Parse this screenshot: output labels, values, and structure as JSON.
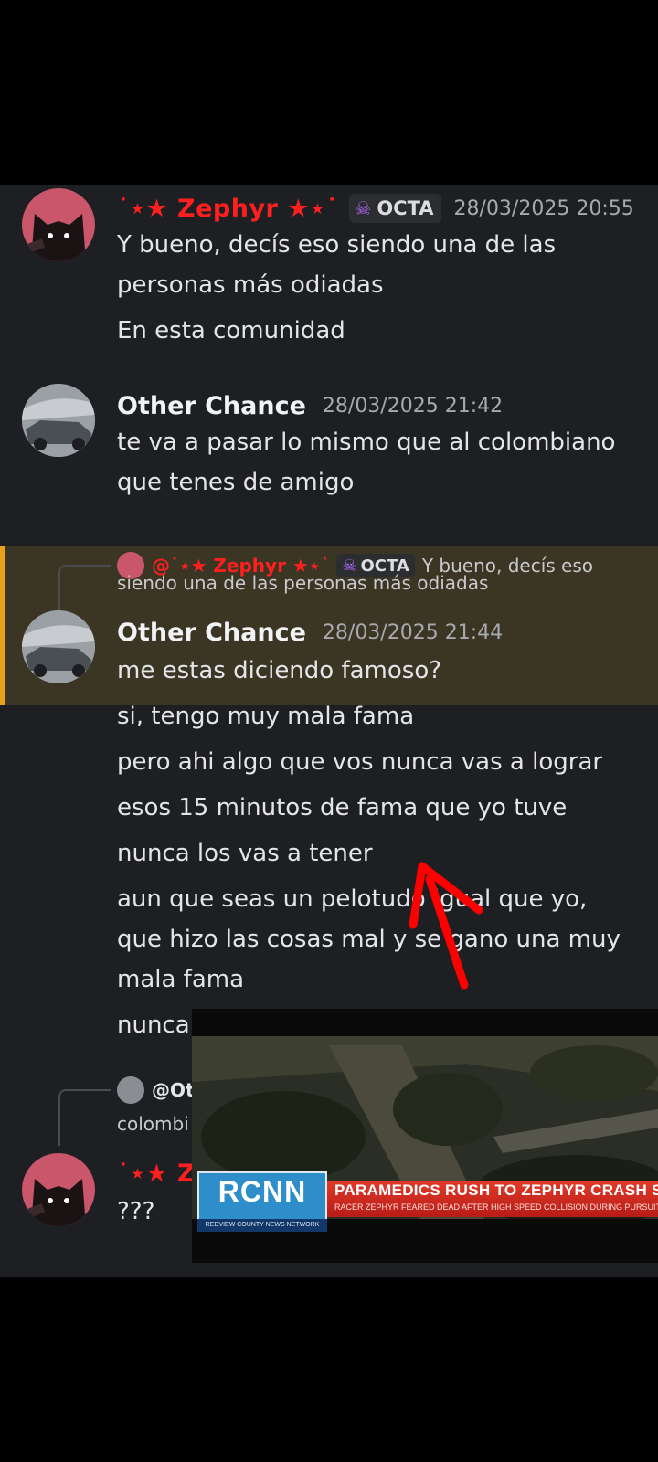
{
  "messages": [
    {
      "author": "˙⋆★ Zephyr ★⋆˙",
      "badge": "OCTA",
      "time": "28/03/2025 20:55",
      "lines": [
        "Y bueno, decís eso siendo una de las",
        "personas más odiadas",
        "En esta comunidad"
      ]
    },
    {
      "author": "Other Chance",
      "time": "28/03/2025 21:42",
      "lines": [
        "te va a pasar lo mismo que al colombiano",
        "que tenes de amigo"
      ]
    },
    {
      "reply": {
        "author": "@˙⋆★ Zephyr ★⋆˙",
        "badge": "OCTA",
        "text1": "Y bueno, decís eso",
        "text2": "siendo una de las personas más odiadas"
      },
      "author": "Other Chance",
      "time": "28/03/2025 21:44",
      "lines": [
        "me estas diciendo famoso?",
        "si, tengo muy mala fama",
        "pero ahi algo que vos nunca vas a lograr",
        "esos 15 minutos de fama que yo tuve",
        "nunca los vas a tener",
        "aun que seas un pelotudo igual que yo,",
        "que hizo las cosas mal y se gano una muy",
        "mala fama",
        "nunca"
      ]
    },
    {
      "reply": {
        "author": "@Ot",
        "text2": "colombi"
      },
      "author": "˙⋆★ Z",
      "lines": [
        "???"
      ]
    }
  ],
  "video": {
    "logo": "RCNN",
    "network": "REDVIEW COUNTY NEWS NETWORK",
    "headline": "PARAMEDICS RUSH TO ZEPHYR CRASH SITE",
    "subheadline": "RACER ZEPHYR FEARED DEAD AFTER HIGH SPEED COLLISION DURING PURSUIT"
  },
  "colors": {
    "background": "#1e1f22",
    "highlight": "#3b3524",
    "highlight_bar": "#e8a21a",
    "username_red": "#ff1f1f",
    "badge_skull": "#b26bff",
    "annotation_arrow": "#ff0000",
    "ticker_red": "#e23a2a",
    "logo_blue": "#2d8ec9"
  },
  "icons": {
    "badge": "skull-icon",
    "annotation": "arrow-annotation-icon"
  }
}
